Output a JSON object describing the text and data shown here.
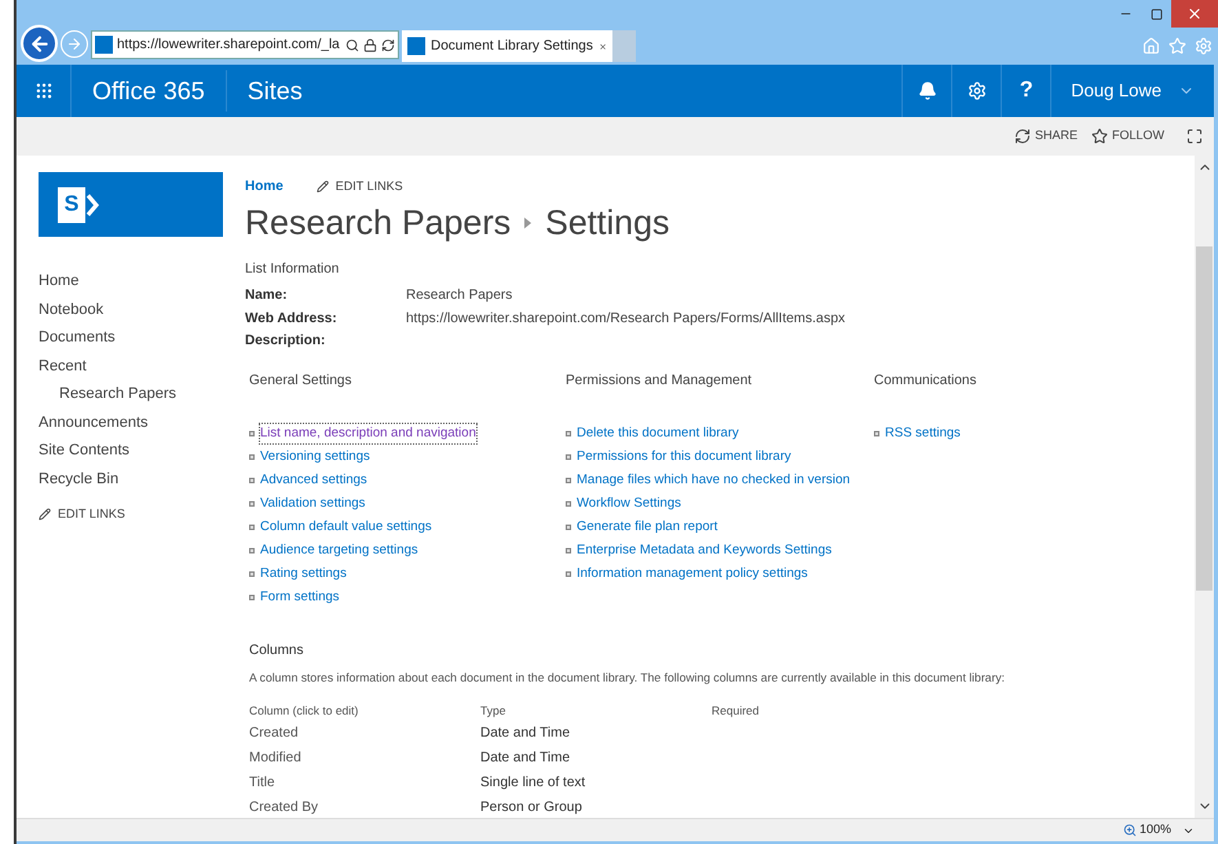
{
  "browser": {
    "address": "https://lowewriter.sharepoint.com/_la",
    "tab_title": "Document Library Settings"
  },
  "suite_bar": {
    "app": "Office 365",
    "section": "Sites",
    "help": "?",
    "user": "Doug Lowe"
  },
  "logo": {
    "letter": "S"
  },
  "actions": [
    {
      "label": "SHARE",
      "kind": "share"
    },
    {
      "label": "FOLLOW",
      "kind": "follow"
    }
  ],
  "breadcrumb": {
    "home": "Home",
    "edit_links": "EDIT LINKS"
  },
  "title": {
    "site": "Research Papers",
    "page": "Settings"
  },
  "nav": [
    {
      "label": "Home"
    },
    {
      "label": "Notebook"
    },
    {
      "label": "Documents"
    },
    {
      "label": "Recent",
      "children": [
        {
          "label": "Research Papers"
        }
      ]
    },
    {
      "label": "Announcements"
    },
    {
      "label": "Site Contents"
    },
    {
      "label": "Recycle Bin"
    }
  ],
  "nav_edit_links": "EDIT LINKS",
  "list_info": {
    "heading": "List Information",
    "fields": [
      {
        "label": "Name:",
        "value": "Research Papers"
      },
      {
        "label": "Web Address:",
        "value": "https://lowewriter.sharepoint.com/Research Papers/Forms/AllItems.aspx"
      },
      {
        "label": "Description:"
      }
    ]
  },
  "sections": [
    {
      "heading": "General Settings",
      "links": [
        {
          "label": "List name, description and navigation",
          "visited": true
        },
        {
          "label": "Versioning settings",
          "visited": false
        },
        {
          "label": "Advanced settings",
          "visited": false
        },
        {
          "label": "Validation settings",
          "visited": false
        },
        {
          "label": "Column default value settings",
          "visited": false
        },
        {
          "label": "Audience targeting settings",
          "visited": false
        },
        {
          "label": "Rating settings",
          "visited": false
        },
        {
          "label": "Form settings",
          "visited": false
        }
      ]
    },
    {
      "heading": "Permissions and Management",
      "links": [
        {
          "label": "Delete this document library",
          "visited": false
        },
        {
          "label": "Permissions for this document library",
          "visited": false
        },
        {
          "label": "Manage files which have no checked in version",
          "visited": false
        },
        {
          "label": "Workflow Settings",
          "visited": false
        },
        {
          "label": "Generate file plan report",
          "visited": false
        },
        {
          "label": "Enterprise Metadata and Keywords Settings",
          "visited": false
        },
        {
          "label": "Information management policy settings",
          "visited": false
        }
      ]
    },
    {
      "heading": "Communications",
      "links": [
        {
          "label": "RSS settings",
          "visited": false
        }
      ]
    }
  ],
  "columns": {
    "heading": "Columns",
    "description": "A column stores information about each document in the document library. The following columns are currently available in this document library:",
    "headers": [
      "Column (click to edit)",
      "Type",
      "Required"
    ],
    "rows": [
      {
        "name": "Created",
        "type": "Date and Time"
      },
      {
        "name": "Modified",
        "type": "Date and Time"
      },
      {
        "name": "Title",
        "type": "Single line of text"
      },
      {
        "name": "Created By",
        "type": "Person or Group"
      }
    ]
  },
  "status_bar": {
    "zoom": "100%"
  }
}
